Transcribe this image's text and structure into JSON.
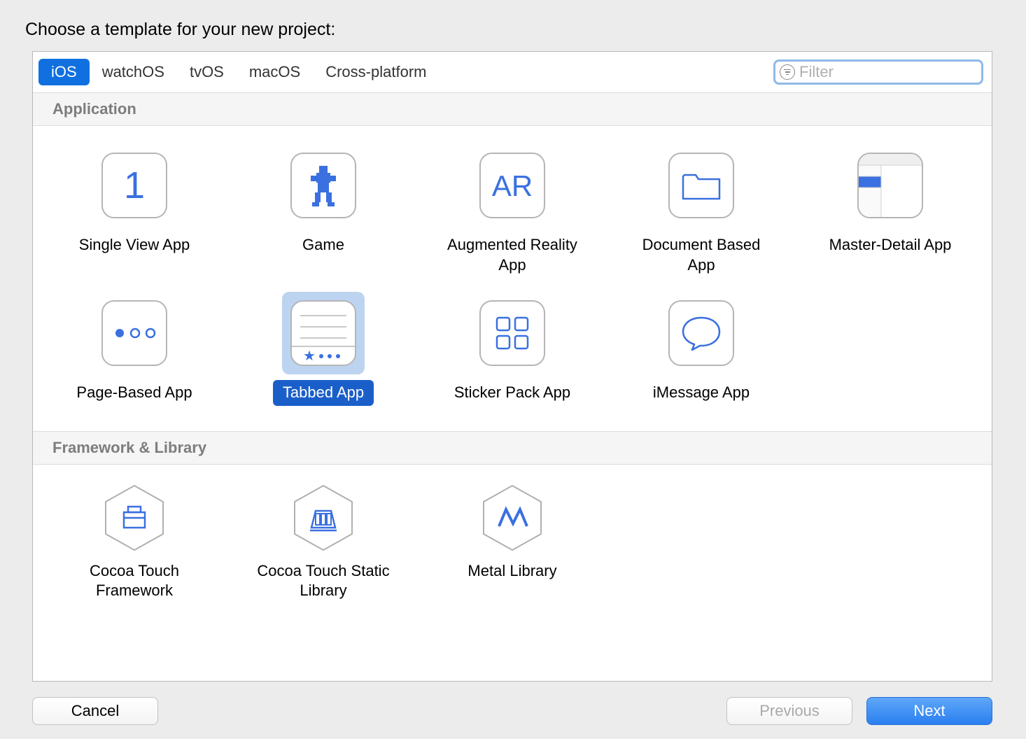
{
  "header": {
    "title": "Choose a template for your new project:"
  },
  "tabs": [
    "iOS",
    "watchOS",
    "tvOS",
    "macOS",
    "Cross-platform"
  ],
  "activeTab": 0,
  "filter": {
    "placeholder": "Filter",
    "value": ""
  },
  "sections": [
    {
      "title": "Application",
      "items": [
        {
          "label": "Single View App",
          "icon": "single-view-icon",
          "selected": false
        },
        {
          "label": "Game",
          "icon": "game-icon",
          "selected": false
        },
        {
          "label": "Augmented Reality App",
          "icon": "ar-icon",
          "selected": false
        },
        {
          "label": "Document Based App",
          "icon": "document-icon",
          "selected": false
        },
        {
          "label": "Master-Detail App",
          "icon": "master-detail-icon",
          "selected": false
        },
        {
          "label": "Page-Based App",
          "icon": "page-based-icon",
          "selected": false
        },
        {
          "label": "Tabbed App",
          "icon": "tabbed-icon",
          "selected": true
        },
        {
          "label": "Sticker Pack App",
          "icon": "sticker-pack-icon",
          "selected": false
        },
        {
          "label": "iMessage App",
          "icon": "imessage-icon",
          "selected": false
        }
      ]
    },
    {
      "title": "Framework & Library",
      "items": [
        {
          "label": "Cocoa Touch Framework",
          "icon": "framework-icon",
          "selected": false
        },
        {
          "label": "Cocoa Touch Static Library",
          "icon": "static-library-icon",
          "selected": false
        },
        {
          "label": "Metal Library",
          "icon": "metal-icon",
          "selected": false
        }
      ]
    }
  ],
  "buttons": {
    "cancel": "Cancel",
    "previous": "Previous",
    "next": "Next"
  },
  "colors": {
    "accent": "#3a70e0",
    "selection": "#1a5fc9"
  }
}
